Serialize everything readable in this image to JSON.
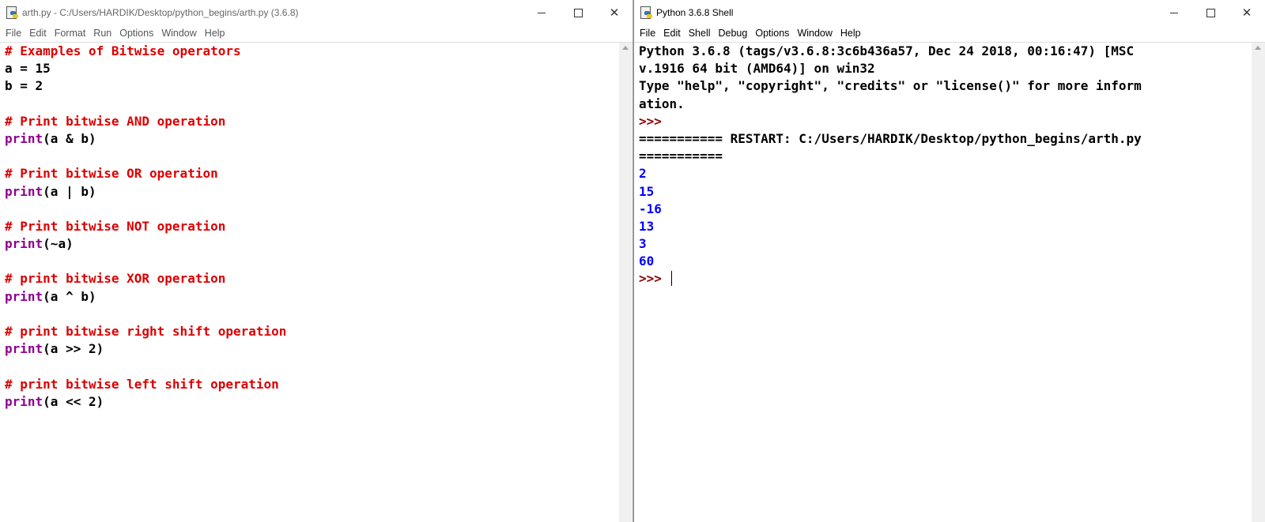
{
  "editor": {
    "title": "arth.py - C:/Users/HARDIK/Desktop/python_begins/arth.py (3.6.8)",
    "icon": "python-file-icon",
    "menu": [
      "File",
      "Edit",
      "Format",
      "Run",
      "Options",
      "Window",
      "Help"
    ],
    "lines": [
      [
        {
          "t": "# Examples of Bitwise operators",
          "c": "comment"
        }
      ],
      [
        {
          "t": "a = 15",
          "c": "normal"
        }
      ],
      [
        {
          "t": "b = 2",
          "c": "normal"
        }
      ],
      [],
      [
        {
          "t": "# Print bitwise AND operation",
          "c": "comment"
        }
      ],
      [
        {
          "t": "print",
          "c": "builtin"
        },
        {
          "t": "(a & b)",
          "c": "normal"
        }
      ],
      [],
      [
        {
          "t": "# Print bitwise OR operation",
          "c": "comment"
        }
      ],
      [
        {
          "t": "print",
          "c": "builtin"
        },
        {
          "t": "(a | b)",
          "c": "normal"
        }
      ],
      [],
      [
        {
          "t": "# Print bitwise NOT operation",
          "c": "comment"
        }
      ],
      [
        {
          "t": "print",
          "c": "builtin"
        },
        {
          "t": "(~a)",
          "c": "normal"
        }
      ],
      [],
      [
        {
          "t": "# print bitwise XOR operation",
          "c": "comment"
        }
      ],
      [
        {
          "t": "print",
          "c": "builtin"
        },
        {
          "t": "(a ^ b)",
          "c": "normal"
        }
      ],
      [],
      [
        {
          "t": "# print bitwise right shift operation",
          "c": "comment"
        }
      ],
      [
        {
          "t": "print",
          "c": "builtin"
        },
        {
          "t": "(a >> 2)",
          "c": "normal"
        }
      ],
      [],
      [
        {
          "t": "# print bitwise left shift operation",
          "c": "comment"
        }
      ],
      [
        {
          "t": "print",
          "c": "builtin"
        },
        {
          "t": "(a << 2)",
          "c": "normal"
        }
      ]
    ]
  },
  "shell": {
    "title": "Python 3.6.8 Shell",
    "icon": "python-shell-icon",
    "menu": [
      "File",
      "Edit",
      "Shell",
      "Debug",
      "Options",
      "Window",
      "Help"
    ],
    "lines": [
      [
        {
          "t": "Python 3.6.8 (tags/v3.6.8:3c6b436a57, Dec 24 2018, 00:16:47) [MSC",
          "c": "banner"
        }
      ],
      [
        {
          "t": "v.1916 64 bit (AMD64)] on win32",
          "c": "banner"
        }
      ],
      [
        {
          "t": "Type \"help\", \"copyright\", \"credits\" or \"license()\" for more inform",
          "c": "banner"
        }
      ],
      [
        {
          "t": "ation.",
          "c": "banner"
        }
      ],
      [
        {
          "t": ">>>",
          "c": "prompt"
        }
      ],
      [
        {
          "t": "=========== RESTART: C:/Users/HARDIK/Desktop/python_begins/arth.py",
          "c": "banner"
        }
      ],
      [
        {
          "t": "===========",
          "c": "banner"
        }
      ],
      [
        {
          "t": "2",
          "c": "out"
        }
      ],
      [
        {
          "t": "15",
          "c": "out"
        }
      ],
      [
        {
          "t": "-16",
          "c": "out"
        }
      ],
      [
        {
          "t": "13",
          "c": "out"
        }
      ],
      [
        {
          "t": "3",
          "c": "out"
        }
      ],
      [
        {
          "t": "60",
          "c": "out"
        }
      ],
      [
        {
          "t": ">>> ",
          "c": "prompt"
        }
      ]
    ]
  },
  "window_controls": {
    "minimize": "minimize-icon",
    "maximize": "maximize-icon",
    "close": "close-icon"
  },
  "colors": {
    "comment": "#dd0000",
    "builtin": "#900090",
    "output": "#0000ff",
    "prompt": "#8b0000"
  }
}
